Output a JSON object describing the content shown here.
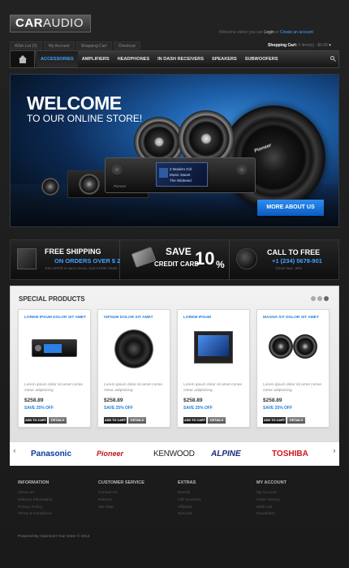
{
  "header": {
    "logo_main": "CAR",
    "logo_rest": "AUDIO",
    "welcome_prefix": "Welcome visitor you can",
    "login": "Login",
    "welcome_or": "or",
    "create_account": "Create an account",
    "top_links": [
      "Wish List (0)",
      "My Account",
      "Shopping Cart",
      "Checkout"
    ],
    "cart_label": "Shopping Cart:",
    "cart_items": "0 item(s) - $0.00",
    "cart_arrow": "▾"
  },
  "nav": {
    "items": [
      "ACCESSORIES",
      "AMPLIFIERS",
      "HEADPHONES",
      "IN DASH RECEIVERS",
      "SPEAKERS",
      "SUBWOOFERS"
    ],
    "active_index": 0
  },
  "hero": {
    "title": "WELCOME",
    "subtitle": "TO OUR ONLINE STORE!",
    "screen_lines": [
      "2 Modern Girl",
      "Music Sweet",
      "The Wideeed"
    ],
    "device_brand": "Pioneer",
    "speaker_brand": "Pioneer",
    "button": "MORE ABOUT US"
  },
  "promos": [
    {
      "line1": "FREE SHIPPING",
      "line2": "ON ORDERS OVER $ 299",
      "line3": "THIS OFFER IS VALID ON ALL OUR STORE ITEMS"
    },
    {
      "line1": "SAVE",
      "line2": "CREDIT CARD",
      "big": "10",
      "pct": "%"
    },
    {
      "line1": "CALL TO FREE",
      "line2": "+1 (234) 5678-901",
      "line3": "TODAY 9AM - 8PM"
    }
  ],
  "special": {
    "title": "SPECIAL PRODUCTS",
    "add_to_cart": "ADD TO CART",
    "details": "DETAILS",
    "products": [
      {
        "name": "LOREM IPSUM DOLOR SIT AMET",
        "desc": "Lorem ipsum dolor sit amet conse ctetur adipisicing",
        "price": "$258.89",
        "save": "SAVE 25% OFF"
      },
      {
        "name": "ISPSUM DOLOR SIT AMET",
        "desc": "Lorem ipsum dolor sit amet conse ctetur adipisicing",
        "price": "$258.89",
        "save": "SAVE 25% OFF"
      },
      {
        "name": "LOREM IPSUM",
        "desc": "Lorem ipsum dolor sit amet conse ctetur adipisicing",
        "price": "$258.89",
        "save": "SAVE 25% OFF"
      },
      {
        "name": "MAGNA SIT DOLOR SIT AMET",
        "desc": "Lorem ipsum dolor sit amet conse ctetur adipisicing",
        "price": "$258.89",
        "save": "SAVE 25% OFF"
      }
    ]
  },
  "brands": [
    "Panasonic",
    "Pioneer",
    "KENWOOD",
    "ALPINE",
    "TOSHIBA"
  ],
  "footer": {
    "columns": [
      {
        "title": "INFORMATION",
        "links": [
          "About Us",
          "Delivery Information",
          "Privacy Policy",
          "Terms & Conditions"
        ]
      },
      {
        "title": "CUSTOMER SERVICE",
        "links": [
          "Contact Us",
          "Returns",
          "Site Map"
        ]
      },
      {
        "title": "EXTRAS",
        "links": [
          "Brands",
          "Gift Vouchers",
          "Affiliates",
          "Specials"
        ]
      },
      {
        "title": "MY ACCOUNT",
        "links": [
          "My Account",
          "Order History",
          "Wish List",
          "Newsletter"
        ]
      }
    ],
    "powered": "Powered By OpenCart Your Store © 2012"
  }
}
